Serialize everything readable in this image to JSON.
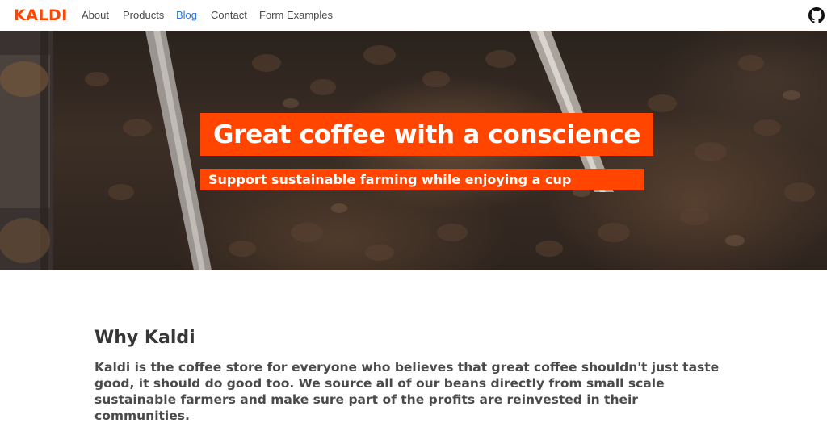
{
  "navbar": {
    "brand": "KALDI",
    "items": [
      {
        "label": "About",
        "active": false
      },
      {
        "label": "Products",
        "active": false
      },
      {
        "label": "Blog",
        "active": true
      },
      {
        "label": "Contact",
        "active": false
      },
      {
        "label": "Form Examples",
        "active": false
      }
    ],
    "right_icon": "github-icon"
  },
  "hero": {
    "title": "Great coffee with a conscience",
    "subtitle": "Support sustainable farming while enjoying a cup",
    "background_image": "coffee-beans-roaster-photo"
  },
  "section": {
    "title": "Why Kaldi",
    "text": "Kaldi is the coffee store for everyone who believes that great coffee shouldn't just taste good, it should do good too. We source all of our beans directly from small scale sustainable farmers and make sure part of the profits are reinvested in their communities."
  },
  "colors": {
    "brand": "#ff4500",
    "link_active": "#3273dc",
    "text": "#363636"
  }
}
